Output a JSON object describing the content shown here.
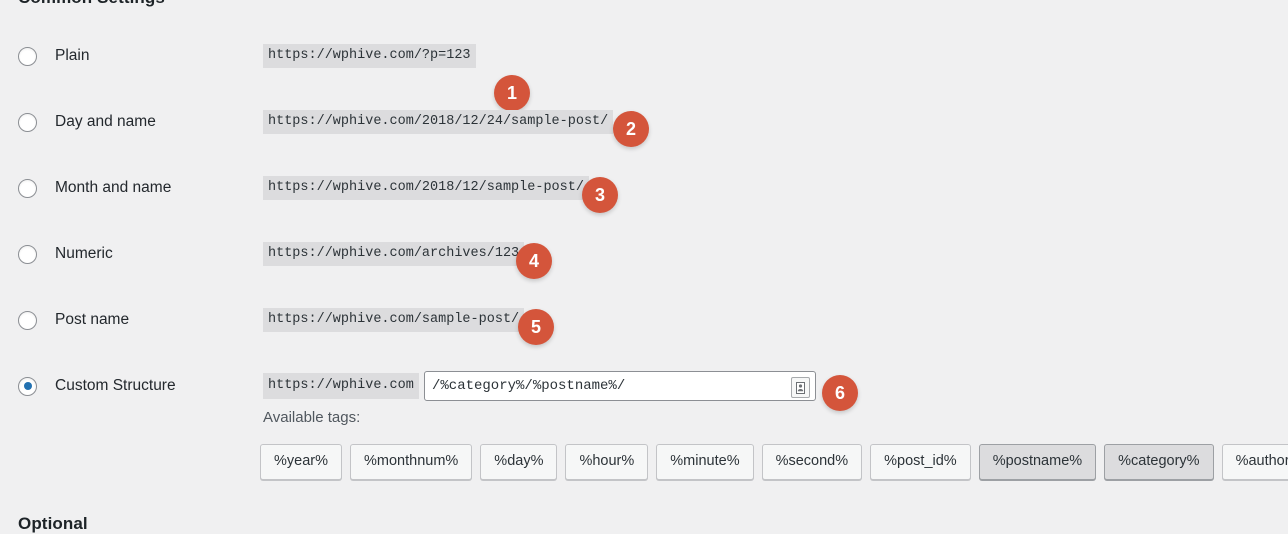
{
  "headings": {
    "top": "Common Settings",
    "bottom": "Optional"
  },
  "options": [
    {
      "label": "Plain",
      "example": "https://wphive.com/?p=123",
      "checked": false,
      "badge": "1"
    },
    {
      "label": "Day and name",
      "example": "https://wphive.com/2018/12/24/sample-post/",
      "checked": false,
      "badge": "2"
    },
    {
      "label": "Month and name",
      "example": "https://wphive.com/2018/12/sample-post/",
      "checked": false,
      "badge": "3"
    },
    {
      "label": "Numeric",
      "example": "https://wphive.com/archives/123",
      "checked": false,
      "badge": "4"
    },
    {
      "label": "Post name",
      "example": "https://wphive.com/sample-post/",
      "checked": false,
      "badge": "5"
    },
    {
      "label": "Custom Structure",
      "example": "https://wphive.com",
      "checked": true,
      "badge": "6"
    }
  ],
  "custom_structure": {
    "prefix": "https://wphive.com",
    "value": "/%category%/%postname%/",
    "placeholder": "",
    "autofill_icon": "contact-card-icon"
  },
  "available_tags": {
    "label": "Available tags:",
    "tags": [
      {
        "label": "%year%",
        "used": false
      },
      {
        "label": "%monthnum%",
        "used": false
      },
      {
        "label": "%day%",
        "used": false
      },
      {
        "label": "%hour%",
        "used": false
      },
      {
        "label": "%minute%",
        "used": false
      },
      {
        "label": "%second%",
        "used": false
      },
      {
        "label": "%post_id%",
        "used": false
      },
      {
        "label": "%postname%",
        "used": true
      },
      {
        "label": "%category%",
        "used": true
      },
      {
        "label": "%author%",
        "used": false
      }
    ]
  },
  "colors": {
    "background": "#f0f0f1",
    "badge": "#d4553b",
    "radio_checked": "#2271b1",
    "code_background": "#dcdcde"
  }
}
